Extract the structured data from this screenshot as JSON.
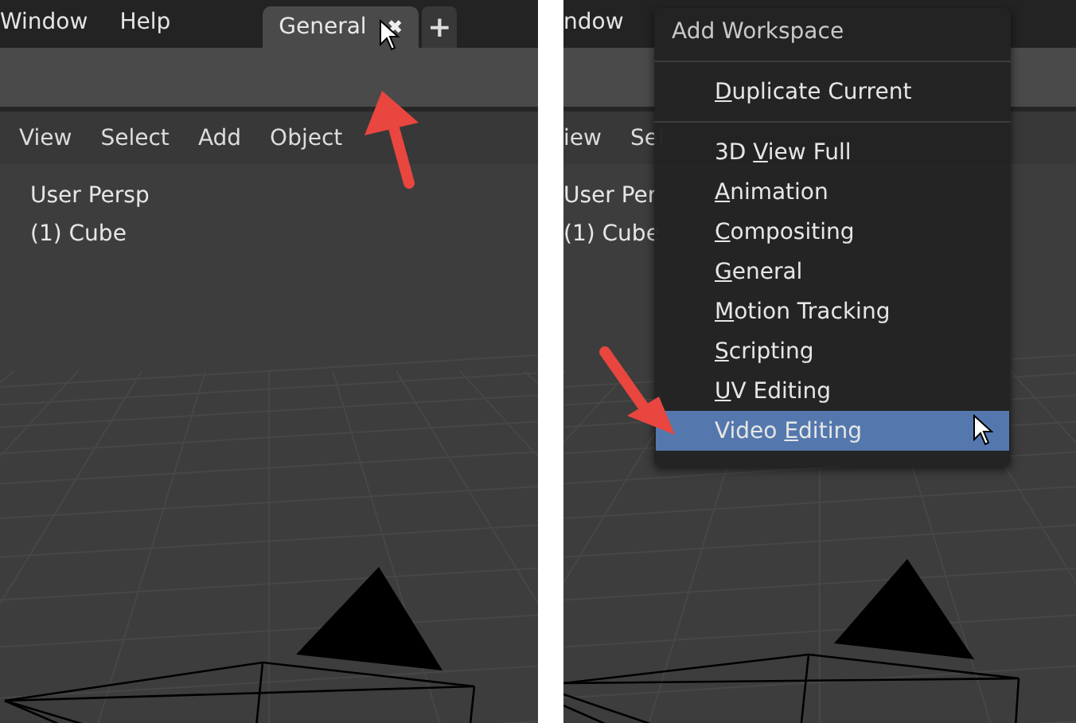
{
  "panels": [
    {
      "topbar": {
        "menus": [
          "Window",
          "Help"
        ],
        "tab": {
          "label": "General",
          "close": "✖"
        },
        "add_button": "+"
      },
      "header_menus": [
        "View",
        "Select",
        "Add",
        "Object"
      ],
      "viewport_labels": [
        "User Persp",
        "(1) Cube"
      ]
    },
    {
      "topbar": {
        "menus": [
          "ndow"
        ]
      },
      "header_menus": [
        "iew",
        "Sel"
      ],
      "viewport_labels": [
        "User Per",
        "(1) Cube"
      ],
      "dropdown": {
        "title": "Add Workspace",
        "sections": [
          [
            {
              "key": "D",
              "after": "uplicate Current",
              "selected": false
            }
          ],
          [
            {
              "before": "3D ",
              "key": "V",
              "after": "iew Full",
              "selected": false
            },
            {
              "key": "A",
              "after": "nimation",
              "selected": false
            },
            {
              "key": "C",
              "after": "ompositing",
              "selected": false
            },
            {
              "key": "G",
              "after": "eneral",
              "selected": false
            },
            {
              "key": "M",
              "after": "otion Tracking",
              "selected": false
            },
            {
              "key": "S",
              "after": "cripting",
              "selected": false
            },
            {
              "key": "U",
              "after": "V Editing",
              "selected": false
            },
            {
              "before": "Video ",
              "key": "E",
              "after": "diting",
              "selected": true
            }
          ]
        ]
      }
    }
  ]
}
